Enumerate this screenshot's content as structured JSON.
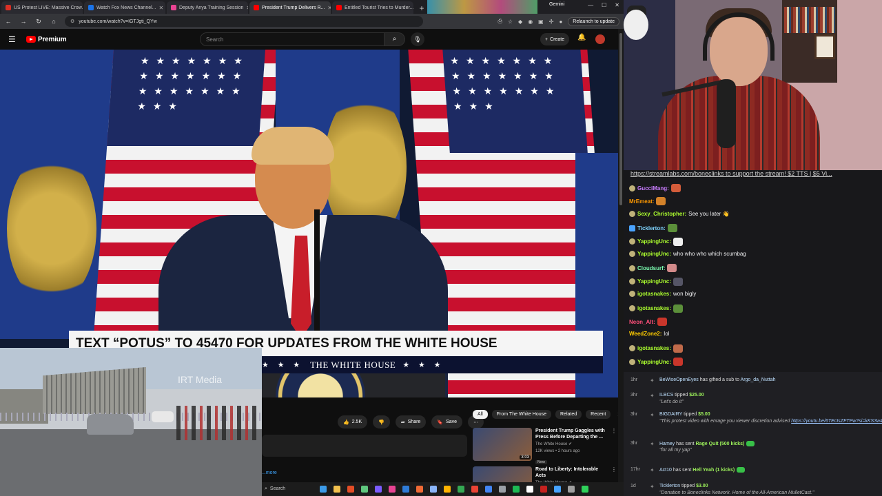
{
  "browser": {
    "tabs": [
      {
        "title": "US Protest LIVE: Massive Crow...",
        "fav": "#d93025",
        "active": false
      },
      {
        "title": "Watch Fox News Channel...",
        "fav": "#1a73e8",
        "active": false
      },
      {
        "title": "Deputy Anya Training Session",
        "fav": "#e84393",
        "active": false
      },
      {
        "title": "President Trump Delivers R...",
        "fav": "#ff0000",
        "active": true
      },
      {
        "title": "Entitled Tourist Tries to Murder...",
        "fav": "#ff0000",
        "active": false
      }
    ],
    "new_tab_glyph": "+",
    "gemini_label": "Gemini",
    "url": "youtube.com/watch?v=IGTJgti_QYw",
    "relaunch_label": "Relaunch to update"
  },
  "youtube": {
    "logo_text": "Premium",
    "search_placeholder": "Search",
    "create_label": "Create",
    "video": {
      "lower_third_headline": "TEXT “POTUS” TO 45470 FOR UPDATES FROM THE WHITE HOUSE",
      "lower_third_org": "THE WHITE HOUSE",
      "lower_third_stars": "★ ★ ★"
    },
    "actions": {
      "likes": "2.5K",
      "share_label": "Share",
      "save_label": "Save",
      "more_glyph": "⋯"
    },
    "description_more": "...more",
    "chips": [
      "All",
      "From The White House",
      "Related",
      "Recent"
    ],
    "recommendations": [
      {
        "title": "President Trump Gaggles with Press Before Departing the ...",
        "channel": "The White House",
        "meta": "12K views • 2 hours ago",
        "badge": "New",
        "duration": "3:03"
      },
      {
        "title": "Road to Liberty: Intolerable Acts",
        "channel": "The White House",
        "meta": "",
        "badge": "",
        "duration": ""
      }
    ]
  },
  "overlay": {
    "irt_label": "IRT Media"
  },
  "taskbar": {
    "search_label": "Search",
    "icons": [
      "#3c9be8",
      "#f2c14e",
      "#e44d26",
      "#5fc77e",
      "#7b5cff",
      "#e84393",
      "#2e7bd6",
      "#f06a35",
      "#8ab4f8",
      "#ffb300",
      "#34a853",
      "#ea4335",
      "#4285f4",
      "#9aa0a6",
      "#1db954",
      "#ffffff",
      "#c5221f",
      "#46a3ff",
      "#a0a0a0",
      "#2fd15a"
    ]
  },
  "chat": {
    "pinned": "https://streamlabs.com/boneclinks to support the stream! $2 TTS | $5 Vi...",
    "messages": [
      {
        "user": "GucciMang:",
        "color": "#c97dff",
        "text": "",
        "emote": "#d35c3a",
        "badge": "gold"
      },
      {
        "user": "MrEmeat:",
        "color": "#ff9900",
        "text": "",
        "emote": "#d3822a",
        "badge": ""
      },
      {
        "user": "Sexy_Christopher:",
        "color": "#adff2f",
        "text": "See you later 👋",
        "emote": "",
        "badge": "gold"
      },
      {
        "user": "Ticklerton:",
        "color": "#7fd4ff",
        "text": "",
        "emote": "#5b8f3a",
        "badge": "blue"
      },
      {
        "user": "YappingUnc:",
        "color": "#adff2f",
        "text": "",
        "emote": "#eeeeee",
        "badge": "gold"
      },
      {
        "user": "YappingUnc:",
        "color": "#adff2f",
        "text": "who who who which scumbag",
        "emote": "",
        "badge": "gold"
      },
      {
        "user": "Cloudsurf:",
        "color": "#7cffb2",
        "text": "",
        "emote": "#d28a8a",
        "badge": "gold"
      },
      {
        "user": "YappingUnc:",
        "color": "#adff2f",
        "text": "",
        "emote": "#555566",
        "badge": "gold"
      },
      {
        "user": "igotasnakes:",
        "color": "#adff2f",
        "text": "won bigly",
        "emote": "",
        "badge": "gold"
      },
      {
        "user": "igotasnakes:",
        "color": "#adff2f",
        "text": "",
        "emote": "#5b8f3a",
        "badge": "gold"
      },
      {
        "user": "Neon_Alt:",
        "color": "#ff4f7a",
        "text": "",
        "emote": "#c9362b",
        "badge": ""
      },
      {
        "user": "WeedZone2:",
        "color": "#ffcc00",
        "text": "lol",
        "emote": "",
        "badge": ""
      },
      {
        "user": "igotasnakes:",
        "color": "#adff2f",
        "text": "",
        "emote": "#c06a4a",
        "badge": "gold"
      },
      {
        "user": "YappingUnc:",
        "color": "#adff2f",
        "text": "",
        "emote": "#c9362b",
        "badge": "gold"
      }
    ],
    "events": [
      {
        "time": "1hr",
        "name": "BeWiseOpenEyes",
        "action": "has gifted a sub to",
        "target": "Argo_da_Nuttah",
        "amount": "",
        "sub": "",
        "link": ""
      },
      {
        "time": "3hr",
        "name": "ILBCS",
        "action": "tipped",
        "target": "",
        "amount": "$25.00",
        "sub": "\"Let's do it\"",
        "link": ""
      },
      {
        "time": "3hr",
        "name": "BIGDAIRY",
        "action": "tipped",
        "target": "",
        "amount": "$5.00",
        "sub": "\"This protest video with enrage you viewer discretion advised",
        "link": "https://youtu.be/6TEcIsZFTPw?si=kKS3w4SVf84Ilikh\""
      },
      {
        "time": "3hr",
        "name": "Hamey",
        "action": "has sent",
        "target": "",
        "amount": "Rage Quit (500 kicks)",
        "sub": "\"for all my yap\"",
        "link": ""
      },
      {
        "time": "17hr",
        "name": "Act10",
        "action": "has sent",
        "target": "",
        "amount": "Hell Yeah (1 kicks)",
        "sub": "",
        "link": ""
      },
      {
        "time": "1d",
        "name": "Ticklerton",
        "action": "tipped",
        "target": "",
        "amount": "$3.00",
        "sub": "\"Donation to Boneclinks Network. Home of the All-American MulletCast.\"",
        "link": ""
      }
    ]
  }
}
